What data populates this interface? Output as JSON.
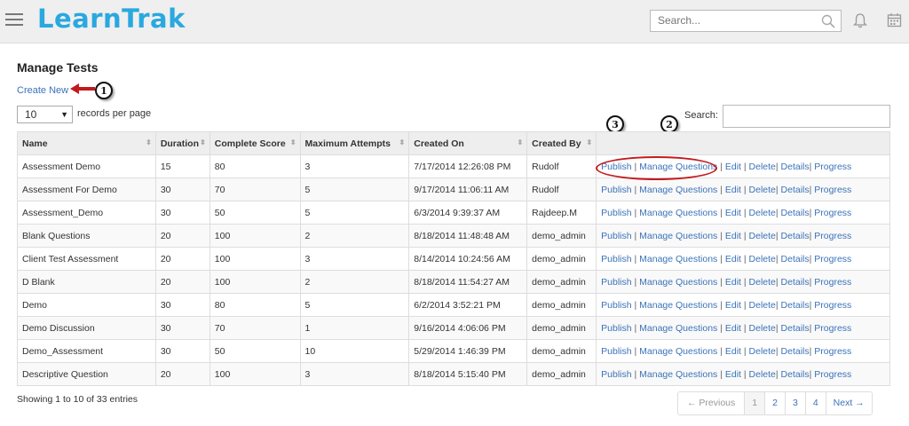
{
  "app": {
    "logo": "LearnTrak",
    "search_placeholder": "Search..."
  },
  "page": {
    "title": "Manage Tests",
    "create_new": "Create New",
    "length_value": "10",
    "length_label": "records per page",
    "search_label": "Search:",
    "search_value": ""
  },
  "callouts": [
    "1",
    "2",
    "3"
  ],
  "table": {
    "columns": [
      "Name",
      "Duration",
      "Complete Score",
      "Maximum Attempts",
      "Created On",
      "Created By",
      ""
    ],
    "actions": [
      "Publish",
      "Manage Questions",
      "Edit",
      "Delete",
      "Details",
      "Progress"
    ],
    "rows": [
      [
        "Assessment Demo",
        "15",
        "80",
        "3",
        "7/17/2014 12:26:08 PM",
        "Rudolf"
      ],
      [
        "Assessment For Demo",
        "30",
        "70",
        "5",
        "9/17/2014 11:06:11 AM",
        "Rudolf"
      ],
      [
        "Assessment_Demo",
        "30",
        "50",
        "5",
        "6/3/2014 9:39:37 AM",
        "Rajdeep.M"
      ],
      [
        "Blank Questions",
        "20",
        "100",
        "2",
        "8/18/2014 11:48:48 AM",
        "demo_admin"
      ],
      [
        "Client Test Assessment",
        "20",
        "100",
        "3",
        "8/14/2014 10:24:56 AM",
        "demo_admin"
      ],
      [
        "D Blank",
        "20",
        "100",
        "2",
        "8/18/2014 11:54:27 AM",
        "demo_admin"
      ],
      [
        "Demo",
        "30",
        "80",
        "5",
        "6/2/2014 3:52:21 PM",
        "demo_admin"
      ],
      [
        "Demo Discussion",
        "30",
        "70",
        "1",
        "9/16/2014 4:06:06 PM",
        "demo_admin"
      ],
      [
        "Demo_Assessment",
        "30",
        "50",
        "10",
        "5/29/2014 1:46:39 PM",
        "demo_admin"
      ],
      [
        "Descriptive Question",
        "20",
        "100",
        "3",
        "8/18/2014 5:15:40 PM",
        "demo_admin"
      ]
    ]
  },
  "footer": {
    "info": "Showing 1 to 10 of 33 entries",
    "prev": "← Previous",
    "pages": [
      "1",
      "2",
      "3",
      "4"
    ],
    "next": "Next →"
  },
  "colors": {
    "brand": "#2aa8df",
    "link": "#3b73b9",
    "annotation": "#c21a1f"
  },
  "icons": [
    "menu-icon",
    "search-icon",
    "bell-icon",
    "calendar-icon",
    "sort-icon",
    "caret-down-icon"
  ]
}
